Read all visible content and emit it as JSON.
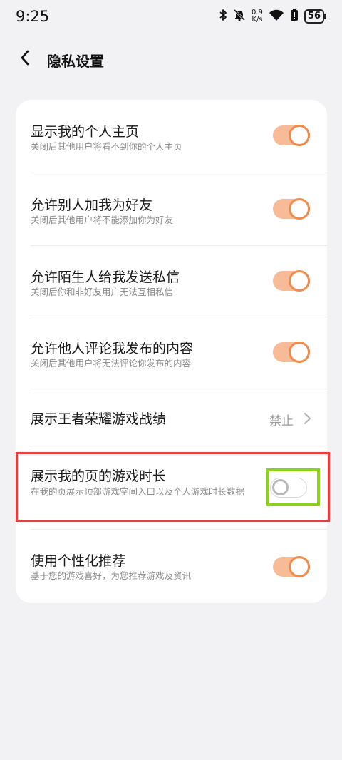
{
  "status_bar": {
    "time": "9:25",
    "net_speed_value": "0.9",
    "net_speed_unit": "K/s",
    "battery": "56",
    "icons": [
      "bluetooth-icon",
      "mute-bell-icon",
      "wifi-icon",
      "battery-saver-icon"
    ]
  },
  "header": {
    "title": "隐私设置",
    "back_icon": "chevron-left-icon"
  },
  "settings": [
    {
      "title": "显示我的个人主页",
      "subtitle": "关闭后其他用户将看不到你的个人主页",
      "toggle": "on"
    },
    {
      "title": "允许别人加我为好友",
      "subtitle": "关闭后其他用户将不能添加你为好友",
      "toggle": "on"
    },
    {
      "title": "允许陌生人给我发送私信",
      "subtitle": "关闭后你和非好友用户无法互相私信",
      "toggle": "on"
    },
    {
      "title": "允许他人评论我发布的内容",
      "subtitle": "关闭后其他用户将无法评论你发布的内容",
      "toggle": "on"
    },
    {
      "title": "展示王者荣耀游戏战绩",
      "value": "禁止"
    },
    {
      "title": "展示我的页的游戏时长",
      "subtitle": "在我的页展示顶部游戏空间入口以及个人游戏时长数据",
      "toggle": "off"
    },
    {
      "title": "使用个性化推荐",
      "subtitle": "基于您的游戏喜好，为您推荐游戏及资讯",
      "toggle": "on"
    }
  ],
  "colors": {
    "accent": "#f18a4b",
    "toggle_track_on": "#f7bc97",
    "highlight_red": "#ee3b3b",
    "highlight_green": "#8ed11c"
  }
}
